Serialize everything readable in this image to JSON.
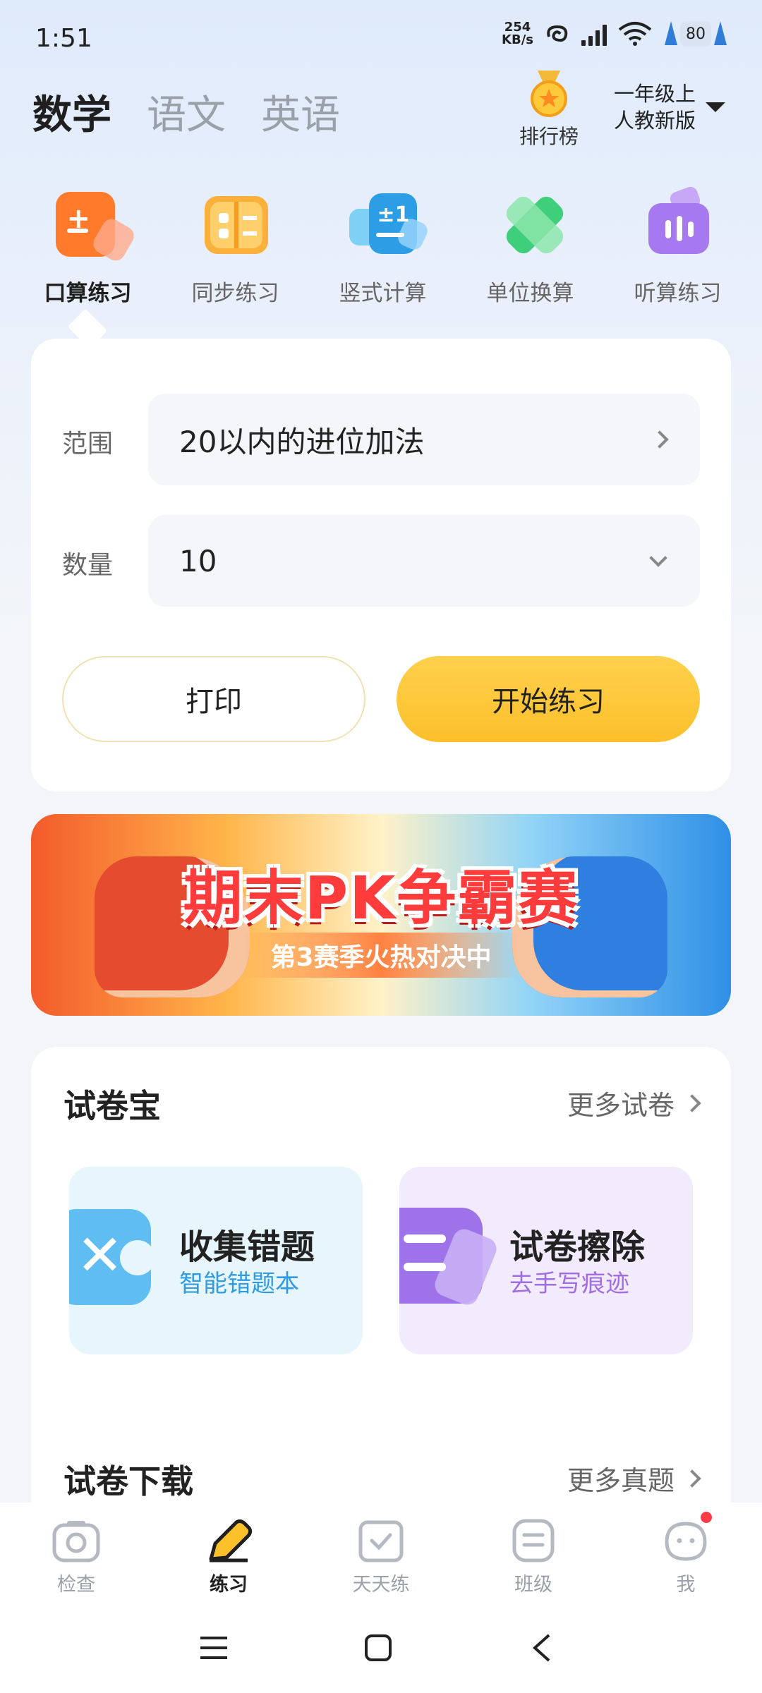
{
  "status": {
    "time": "1:51",
    "net_speed_value": "254",
    "net_speed_unit": "KB/s",
    "battery": "80"
  },
  "header": {
    "subjects": [
      {
        "label": "数学"
      },
      {
        "label": "语文"
      },
      {
        "label": "英语"
      }
    ],
    "rank_label": "排行榜",
    "grade_line1": "一年级上",
    "grade_line2": "人教新版"
  },
  "features": [
    {
      "label": "口算练习",
      "icon": "calc-icon"
    },
    {
      "label": "同步练习",
      "icon": "book-icon"
    },
    {
      "label": "竖式计算",
      "icon": "vertical-calc-icon"
    },
    {
      "label": "单位换算",
      "icon": "ruler-icon"
    },
    {
      "label": "听算练习",
      "icon": "audio-icon"
    }
  ],
  "practice": {
    "range_label": "范围",
    "range_value": "20以内的进位加法",
    "count_label": "数量",
    "count_value": "10",
    "print_label": "打印",
    "start_label": "开始练习"
  },
  "banner": {
    "title": "期末PK争霸赛",
    "subtitle": "第3赛季火热对决中"
  },
  "paper_section": {
    "title": "试卷宝",
    "more": "更多试卷",
    "tiles": [
      {
        "title": "收集错题",
        "subtitle": "智能错题本",
        "accent": "#2f9be0"
      },
      {
        "title": "试卷擦除",
        "subtitle": "去手写痕迹",
        "accent": "#a06ee0"
      }
    ]
  },
  "download_section": {
    "title": "试卷下载",
    "more": "更多真题"
  },
  "bottom_nav": [
    {
      "label": "检查",
      "icon": "camera-icon"
    },
    {
      "label": "练习",
      "icon": "pencil-icon"
    },
    {
      "label": "天天练",
      "icon": "calendar-check-icon"
    },
    {
      "label": "班级",
      "icon": "class-list-icon"
    },
    {
      "label": "我",
      "icon": "profile-face-icon"
    }
  ],
  "colors": {
    "accent_yellow": "#fcc02a",
    "text_dark": "#1f1f1f",
    "text_muted": "#9aa0a8"
  }
}
